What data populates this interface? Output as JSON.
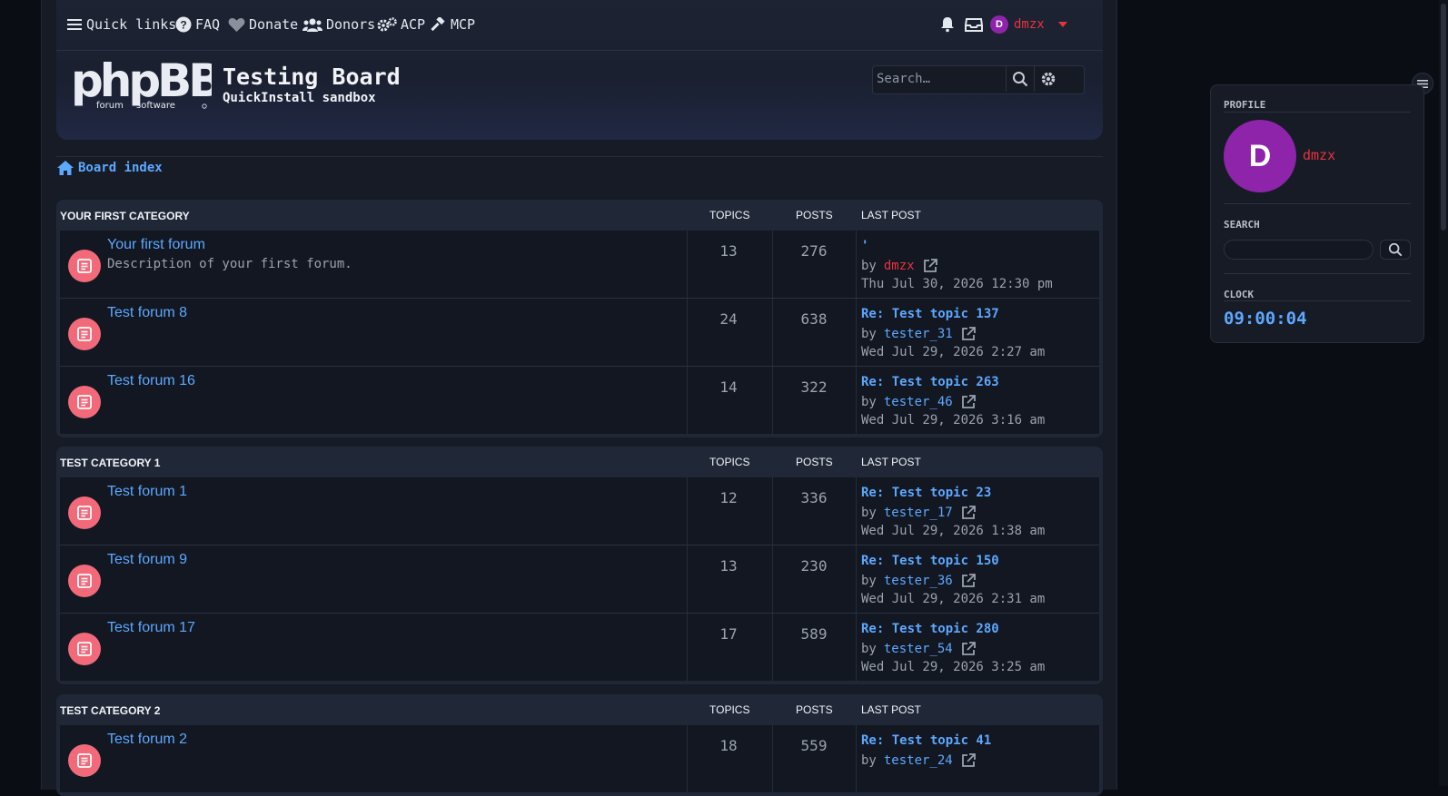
{
  "nav": {
    "quick_links": "Quick links",
    "faq": "FAQ",
    "donate": "Donate",
    "donors": "Donors",
    "acp": "ACP",
    "mcp": "MCP",
    "avatar_letter": "D",
    "username": "dmzx"
  },
  "header": {
    "site_title": "Testing Board",
    "site_desc": "QuickInstall sandbox",
    "search_placeholder": "Search…"
  },
  "breadcrumb": {
    "board_index": "Board index"
  },
  "columns": {
    "topics": "TOPICS",
    "posts": "POSTS",
    "last_post": "LAST POST"
  },
  "categories": [
    {
      "title": "YOUR FIRST CATEGORY",
      "forums": [
        {
          "name": "Your first forum",
          "desc": "Description of your first forum.",
          "topics": "13",
          "posts": "276",
          "lp_title": "'",
          "by": "by",
          "lp_user": "dmzx",
          "lp_date": "Thu Jul 30, 2026 12:30 pm"
        },
        {
          "name": "Test forum 8",
          "desc": "",
          "topics": "24",
          "posts": "638",
          "lp_title": "Re: Test topic 137",
          "by": "by",
          "lp_user": "tester_31",
          "lp_date": "Wed Jul 29, 2026 2:27 am"
        },
        {
          "name": "Test forum 16",
          "desc": "",
          "topics": "14",
          "posts": "322",
          "lp_title": "Re: Test topic 263",
          "by": "by",
          "lp_user": "tester_46",
          "lp_date": "Wed Jul 29, 2026 3:16 am"
        }
      ]
    },
    {
      "title": "TEST CATEGORY 1",
      "forums": [
        {
          "name": "Test forum 1",
          "desc": "",
          "topics": "12",
          "posts": "336",
          "lp_title": "Re: Test topic 23",
          "by": "by",
          "lp_user": "tester_17",
          "lp_date": "Wed Jul 29, 2026 1:38 am"
        },
        {
          "name": "Test forum 9",
          "desc": "",
          "topics": "13",
          "posts": "230",
          "lp_title": "Re: Test topic 150",
          "by": "by",
          "lp_user": "tester_36",
          "lp_date": "Wed Jul 29, 2026 2:31 am"
        },
        {
          "name": "Test forum 17",
          "desc": "",
          "topics": "17",
          "posts": "589",
          "lp_title": "Re: Test topic 280",
          "by": "by",
          "lp_user": "tester_54",
          "lp_date": "Wed Jul 29, 2026 3:25 am"
        }
      ]
    },
    {
      "title": "TEST CATEGORY 2",
      "forums": [
        {
          "name": "Test forum 2",
          "desc": "",
          "topics": "18",
          "posts": "559",
          "lp_title": "Re: Test topic 41",
          "by": "by",
          "lp_user": "tester_24",
          "lp_date": ""
        }
      ]
    }
  ],
  "sidebar": {
    "profile_heading": "PROFILE",
    "avatar_letter": "D",
    "username": "dmzx",
    "search_heading": "SEARCH",
    "clock_heading": "CLOCK",
    "clock_time": "09:00:04"
  },
  "icons": {
    "menu": "menu-icon",
    "faq": "question-circle-icon",
    "donate": "heart-icon",
    "donors": "users-icon",
    "acp": "gears-icon",
    "mcp": "gavel-icon",
    "notifications": "bell-icon",
    "inbox": "inbox-icon",
    "dropdown": "caret-down-icon",
    "search": "search-icon",
    "settings": "gear-icon",
    "home": "home-icon",
    "forum": "forum-read-icon",
    "view": "external-link-icon"
  },
  "colors": {
    "accent": "#5da8ff",
    "admin_red": "#e8333f",
    "forum_icon": "#f26a7a",
    "avatar_bg": "#8e24aa"
  }
}
